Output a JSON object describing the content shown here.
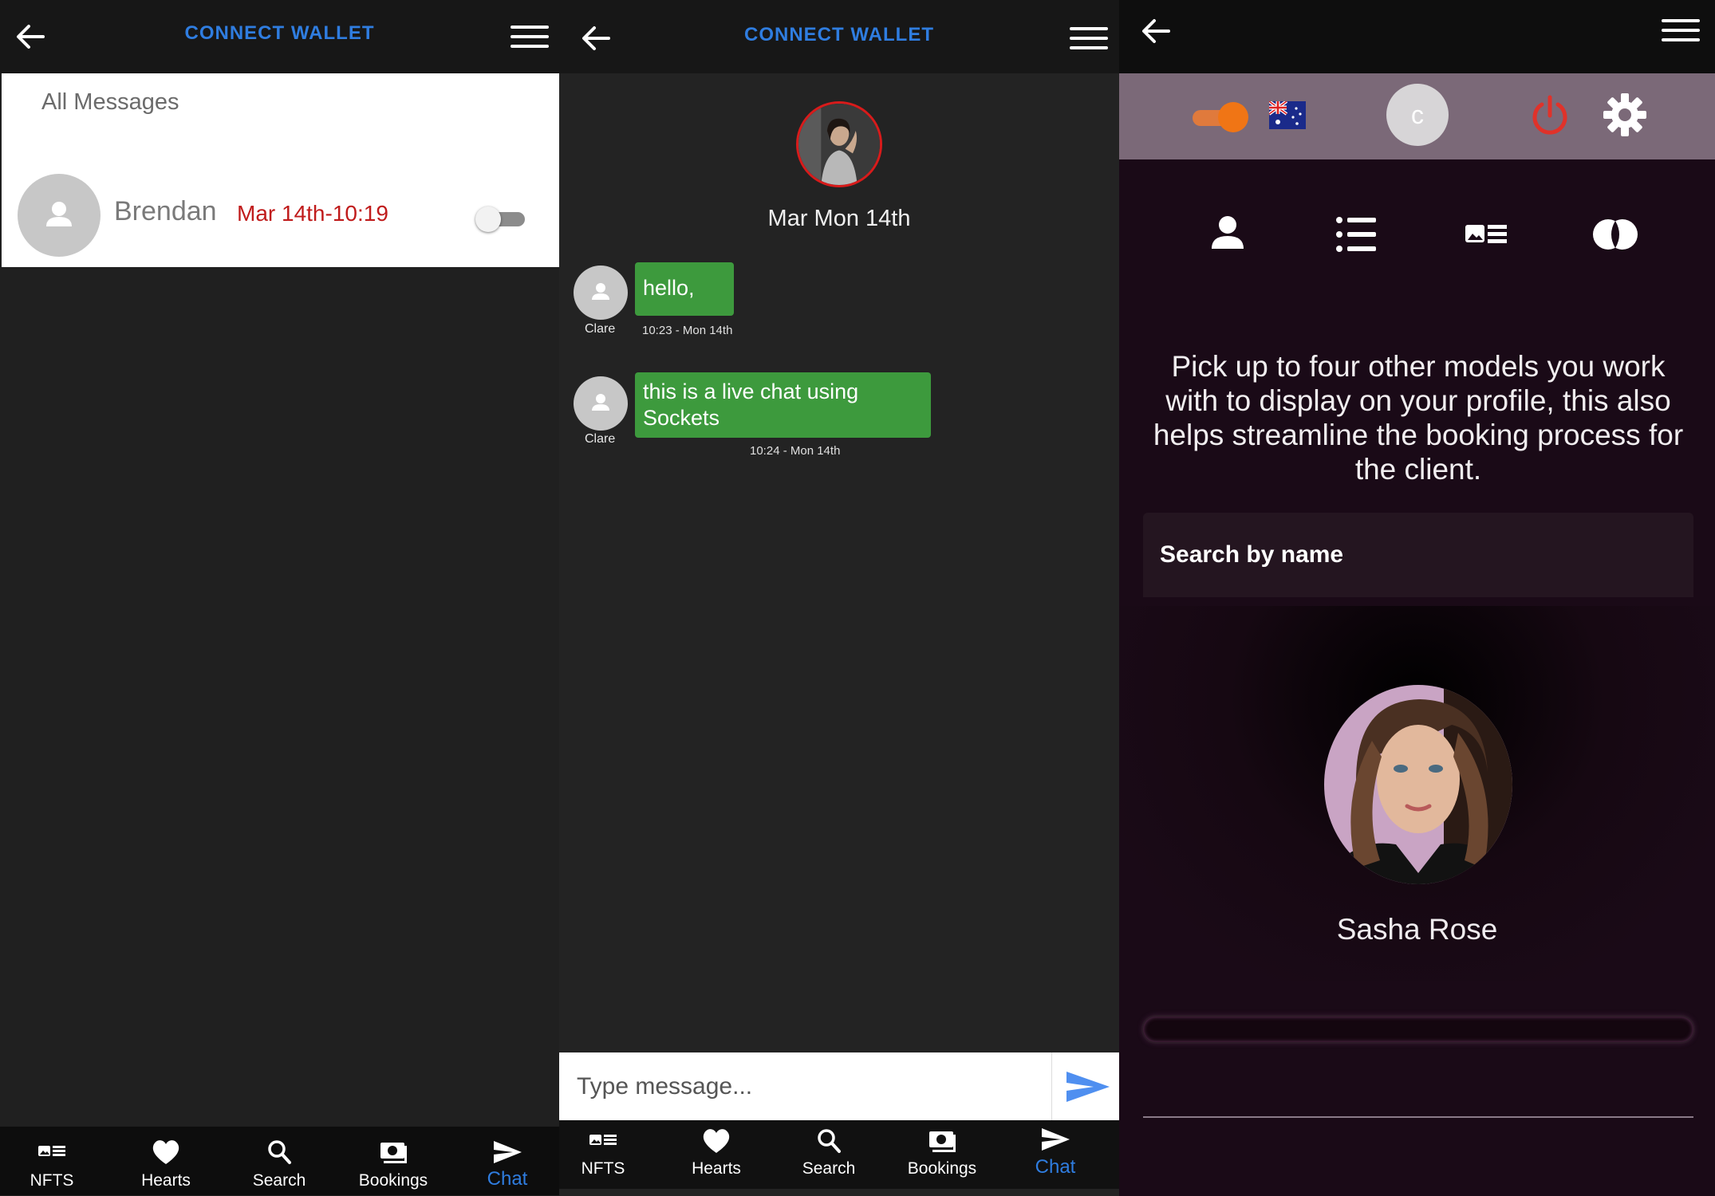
{
  "screen1": {
    "header": {
      "title": "CONNECT WALLET"
    },
    "messages_heading": "All Messages",
    "conversation": {
      "name": "Brendan",
      "time": "Mar 14th-10:19",
      "toggle_on": false
    },
    "nav": [
      {
        "label": "NFTS",
        "icon": "nft-card-icon"
      },
      {
        "label": "Hearts",
        "icon": "heart-icon"
      },
      {
        "label": "Search",
        "icon": "search-icon"
      },
      {
        "label": "Bookings",
        "icon": "bookings-icon"
      },
      {
        "label": "Chat",
        "icon": "send-icon"
      }
    ],
    "active_tab": "Chat"
  },
  "screen2": {
    "header": {
      "title": "CONNECT WALLET"
    },
    "day": "Mar Mon 14th",
    "messages": [
      {
        "sender": "Clare",
        "text": "hello,",
        "time": "10:23 - Mon 14th"
      },
      {
        "sender": "Clare",
        "text": "this is a live chat using Sockets",
        "time": "10:24 - Mon 14th"
      }
    ],
    "input_placeholder": "Type message...",
    "nav": [
      {
        "label": "NFTS",
        "icon": "nft-card-icon"
      },
      {
        "label": "Hearts",
        "icon": "heart-icon"
      },
      {
        "label": "Search",
        "icon": "search-icon"
      },
      {
        "label": "Bookings",
        "icon": "bookings-icon"
      },
      {
        "label": "Chat",
        "icon": "send-icon"
      }
    ],
    "active_tab": "Chat"
  },
  "screen3": {
    "avatar_letter": "c",
    "toggle_on": true,
    "flag": "australia-flag-icon",
    "info_text": "Pick up to four other models you work with to display on your profile, this also helps streamline the booking process for the client.",
    "search_placeholder": "Search by name",
    "model_name": "Sasha Rose",
    "progress": 0
  },
  "colors": {
    "accent_blue": "#2f7de0",
    "bubble_green": "#3d9a3d",
    "time_red": "#c01b1b",
    "orange_toggle": "#f07515",
    "power_red": "#e0322a"
  }
}
